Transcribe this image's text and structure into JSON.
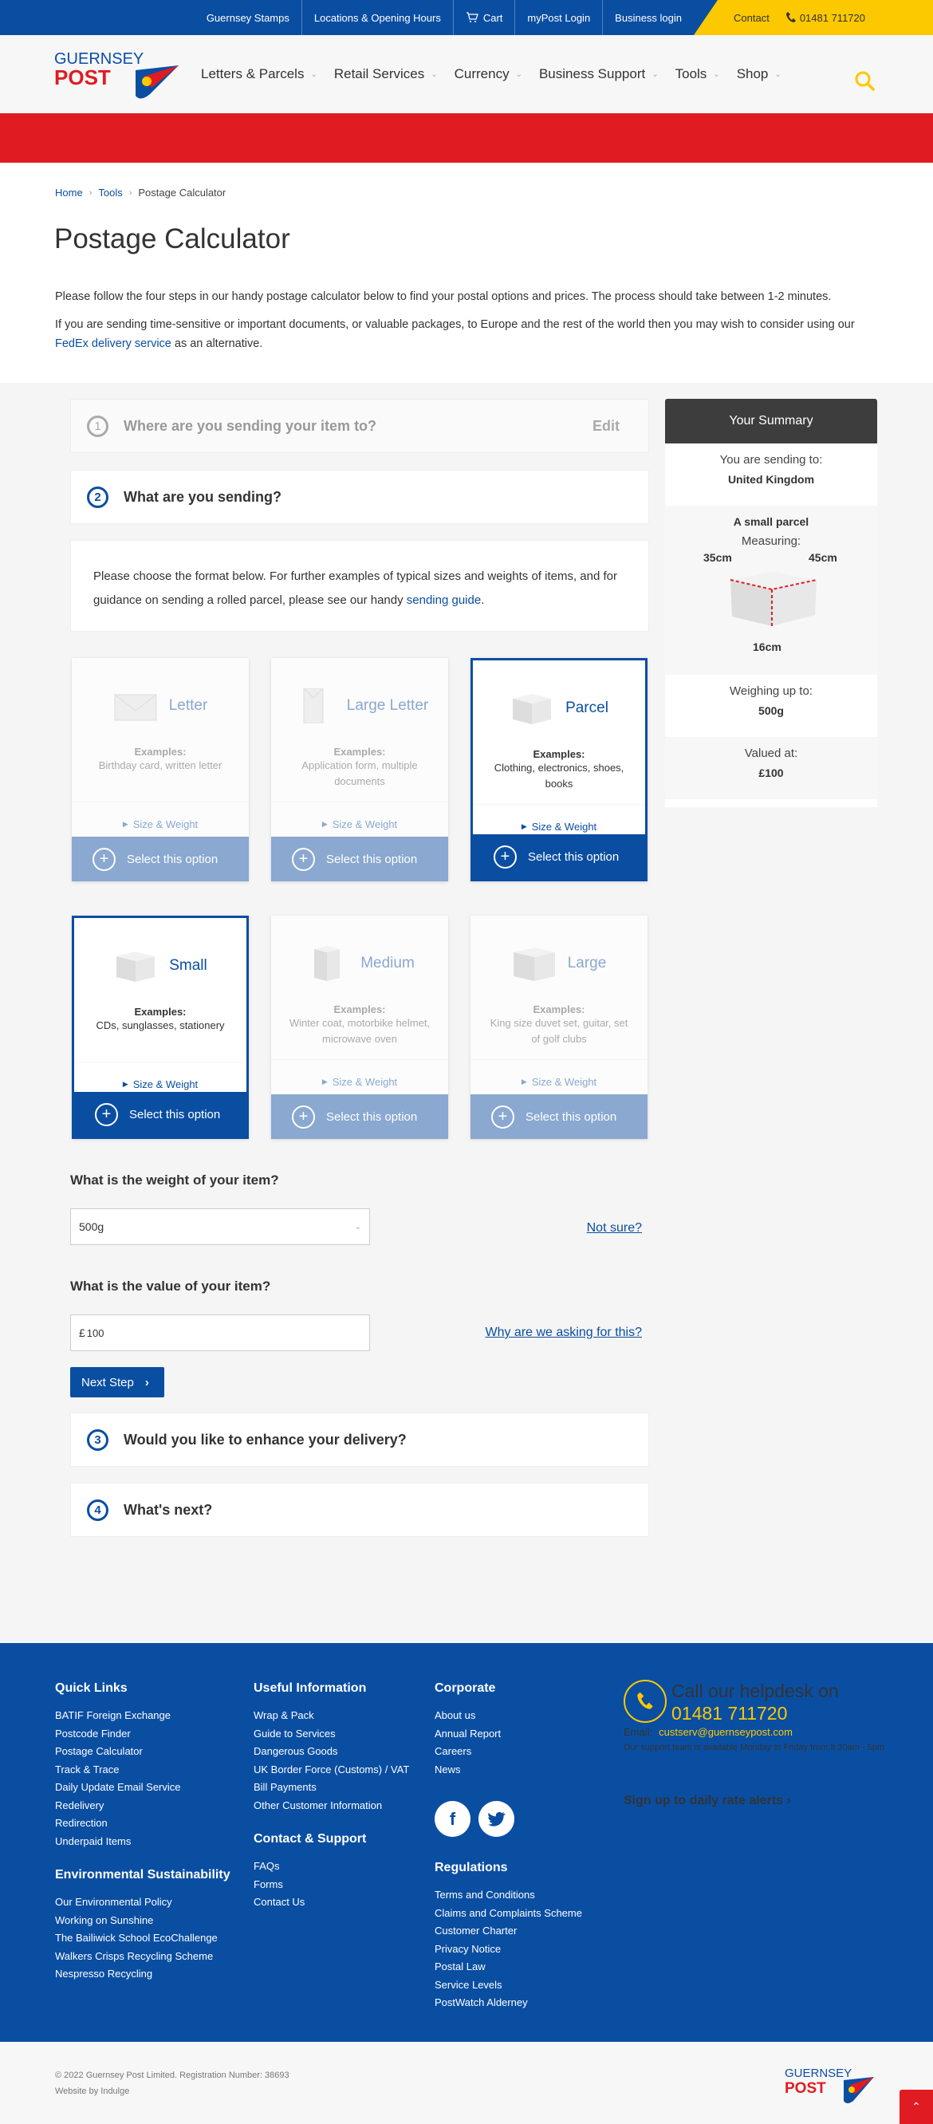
{
  "topbar": {
    "links": [
      "Guernsey Stamps",
      "Locations & Opening Hours",
      "Cart",
      "myPost Login",
      "Business login"
    ],
    "contact": "Contact",
    "phone": "01481 711720"
  },
  "logo": {
    "line1": "GUERNSEY",
    "line2": "POST"
  },
  "nav": {
    "items": [
      "Letters & Parcels",
      "Retail Services",
      "Currency",
      "Business Support",
      "Tools",
      "Shop"
    ],
    "active": "Tools"
  },
  "breadcrumb": {
    "home": "Home",
    "tools": "Tools",
    "current": "Postage Calculator"
  },
  "page_title": "Postage Calculator",
  "intro": {
    "p1": "Please follow the four steps in our handy postage calculator below to find your postal options and prices. The process should take between 1-2 minutes.",
    "p2_before": "If you are sending time-sensitive or important documents, or valuable packages, to Europe and the rest of the world then you may wish to consider using our ",
    "p2_link": "FedEx delivery service",
    "p2_after": " as an alternative."
  },
  "steps": [
    {
      "num": "1",
      "title": "Where are you sending your item to?",
      "edit": "Edit"
    },
    {
      "num": "2",
      "title": "What are you sending?"
    },
    {
      "num": "3",
      "title": "Would you like to enhance your delivery?"
    },
    {
      "num": "4",
      "title": "What's next?"
    }
  ],
  "choose": {
    "text_before": "Please choose the format below. For further examples of typical sizes and weights of items, and for guidance on sending a rolled parcel, please see our handy ",
    "link": "sending guide",
    "text_after": "."
  },
  "formats": [
    {
      "name": "Letter",
      "examples_label": "Examples:",
      "examples": "Birthday card, written letter",
      "size": "Size & Weight",
      "select": "Select this option",
      "selected": false
    },
    {
      "name": "Large Letter",
      "examples_label": "Examples:",
      "examples": "Application form, multiple documents",
      "size": "Size & Weight",
      "select": "Select this option",
      "selected": false
    },
    {
      "name": "Parcel",
      "examples_label": "Examples:",
      "examples": "Clothing, electronics, shoes, books",
      "size": "Size & Weight",
      "select": "Select this option",
      "selected": true
    }
  ],
  "sizes": [
    {
      "name": "Small",
      "examples_label": "Examples:",
      "examples": "CDs, sunglasses, stationery",
      "size": "Size & Weight",
      "select": "Select this option",
      "selected": true
    },
    {
      "name": "Medium",
      "examples_label": "Examples:",
      "examples": "Winter coat, motorbike helmet, microwave oven",
      "size": "Size & Weight",
      "select": "Select this option",
      "selected": false
    },
    {
      "name": "Large",
      "examples_label": "Examples:",
      "examples": "King size duvet set, guitar, set of golf clubs",
      "size": "Size & Weight",
      "select": "Select this option",
      "selected": false
    }
  ],
  "weight": {
    "question": "What is the weight of your item?",
    "value": "500g",
    "help": "Not sure?"
  },
  "value": {
    "question": "What is the value of your item?",
    "currency": "£",
    "value": "100",
    "help": "Why are we asking for this?"
  },
  "next_button": "Next Step",
  "summary": {
    "title": "Your Summary",
    "sending_label": "You are sending to:",
    "sending_value": "United Kingdom",
    "item": "A small parcel",
    "measuring_label": "Measuring:",
    "dim_left": "35cm",
    "dim_right": "45cm",
    "dim_height": "16cm",
    "weight_label": "Weighing up to:",
    "weight_value": "500g",
    "value_label": "Valued at:",
    "value_value": "£100"
  },
  "footer": {
    "quick_links": {
      "title": "Quick Links",
      "items": [
        "BATIF Foreign Exchange",
        "Postcode Finder",
        "Postage Calculator",
        "Track & Trace",
        "Daily Update Email Service",
        "Redelivery",
        "Redirection",
        "Underpaid Items"
      ]
    },
    "environment": {
      "title": "Environmental Sustainability",
      "items": [
        "Our Environmental Policy",
        "Working on Sunshine",
        "The Bailiwick School EcoChallenge",
        "Walkers Crisps Recycling Scheme",
        "Nespresso Recycling"
      ]
    },
    "useful": {
      "title": "Useful Information",
      "items": [
        "Wrap & Pack",
        "Guide to Services",
        "Dangerous Goods",
        "UK Border Force (Customs) / VAT",
        "Bill Payments",
        "Other Customer Information"
      ]
    },
    "contact": {
      "title": "Contact & Support",
      "items": [
        "FAQs",
        "Forms",
        "Contact Us"
      ]
    },
    "corporate": {
      "title": "Corporate",
      "items": [
        "About us",
        "Annual Report",
        "Careers",
        "News"
      ]
    },
    "regulations": {
      "title": "Regulations",
      "items": [
        "Terms and Conditions",
        "Claims and Complaints Scheme",
        "Customer Charter",
        "Privacy Notice",
        "Postal Law",
        "Service Levels",
        "PostWatch Alderney"
      ]
    },
    "helpdesk": {
      "line1": "Call our helpdesk on",
      "phone": "01481 711720",
      "email_label": "Email:",
      "email": "custserv@guernseypost.com",
      "availability": "Our support team is available Monday to Friday from 8:30am - 5pm",
      "signup": "Sign up to daily rate alerts"
    }
  },
  "bottom": {
    "copyright": "© 2022 Guernsey Post Limited. Registration Number: 38693",
    "credit": "Website by Indulge"
  },
  "colors": {
    "brand_blue": "#0a4ea2",
    "brand_red": "#e11b22",
    "brand_yellow": "#fcc800"
  }
}
